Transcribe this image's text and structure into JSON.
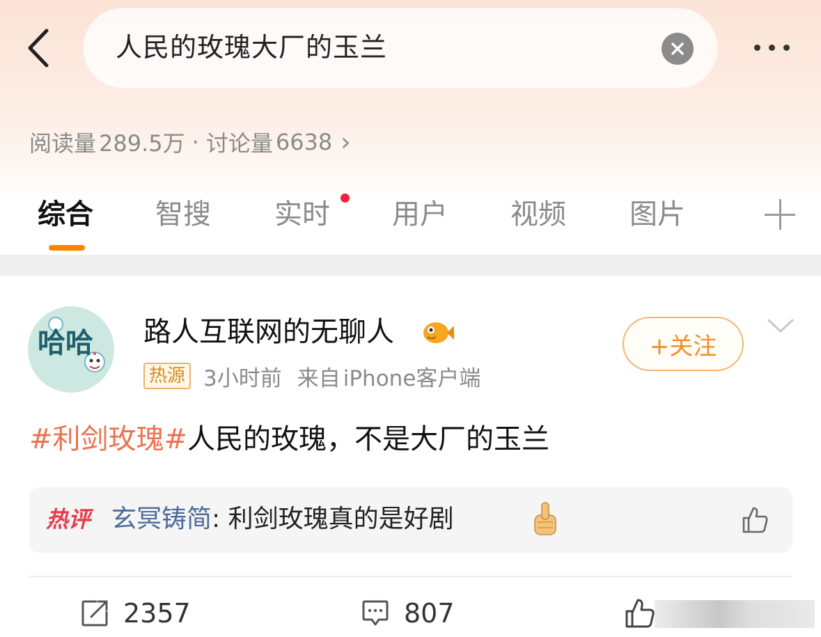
{
  "search": {
    "query": "人民的玫瑰大厂的玉兰"
  },
  "stats": {
    "read_label": "阅读量",
    "read_value": "289.5万",
    "separator": "·",
    "discuss_label": "讨论量",
    "discuss_value": "6638",
    "arrow": "›"
  },
  "tabs": [
    {
      "label": "综合",
      "active": true
    },
    {
      "label": "智搜",
      "active": false
    },
    {
      "label": "实时",
      "active": false,
      "has_dot": true
    },
    {
      "label": "用户",
      "active": false
    },
    {
      "label": "视频",
      "active": false
    },
    {
      "label": "图片",
      "active": false
    }
  ],
  "post": {
    "author": "路人互联网的无聊人",
    "source_badge": "热源",
    "time": "3小时前",
    "from_prefix": "来自",
    "device": "iPhone客户端",
    "follow_label": "+关注",
    "topic": "#利剑玫瑰#",
    "body": "人民的玫瑰，不是大厂的玉兰",
    "avatar_text": "哈哈"
  },
  "hot_comment": {
    "tag": "热评",
    "commenter": "玄冥铸简",
    "separator": ": ",
    "text": "利剑玫瑰真的是好剧"
  },
  "actions": {
    "repost_count": "2357",
    "comment_count": "807"
  },
  "colors": {
    "accent_orange": "#ff8200",
    "topic_color": "#eb7350",
    "commenter_color": "#4b6b9a",
    "red_dot": "#f4213b"
  }
}
